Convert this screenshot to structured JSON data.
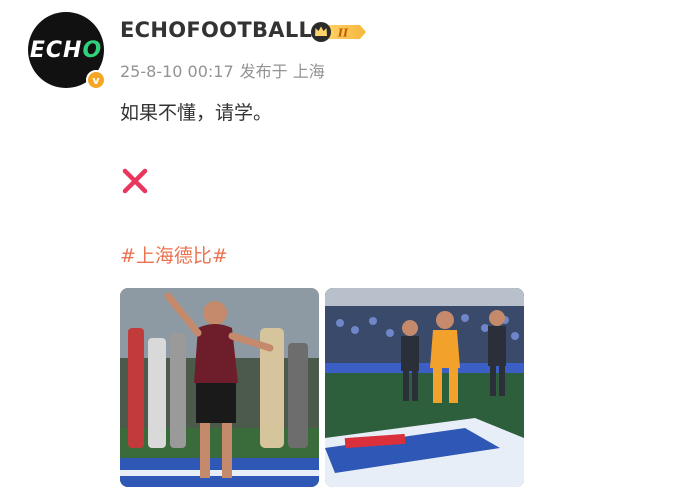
{
  "post": {
    "username": "ECHOFOOTBALL",
    "avatar": {
      "text_main": "ECH",
      "text_accent": "O",
      "badge_glyph": "v"
    },
    "vip_badge": {
      "icon": "crown-icon",
      "level": "II"
    },
    "timestamp": "25-8-10 00:17",
    "source": "发布于 上海",
    "text": "如果不懂，请学。",
    "emoji": "cross-mark-icon",
    "hashtag": "#上海德比#",
    "images": [
      {
        "description_icon": "photo-coach-celebrating"
      },
      {
        "description_icon": "photo-goalkeeper-celebrating"
      }
    ]
  },
  "colors": {
    "username": "#333333",
    "meta": "#939393",
    "hashtag": "#eb7350",
    "cross": "#e8365f",
    "verified": "#f5a623"
  }
}
